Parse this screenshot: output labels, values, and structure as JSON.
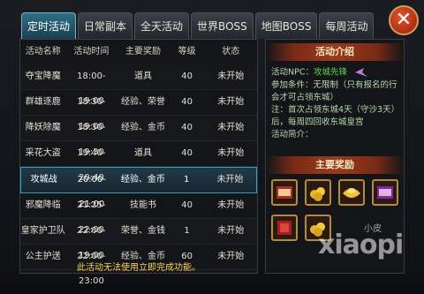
{
  "tabs": [
    "定时活动",
    "日常副本",
    "全天活动",
    "世界BOSS",
    "地图BOSS",
    "每周活动"
  ],
  "close_icon": "close-icon",
  "table": {
    "headers": [
      "活动名称",
      "活动时间",
      "主要奖励",
      "等级",
      "状态"
    ],
    "rows": [
      [
        "夺宝降魔",
        "18:00-19:00",
        "道具",
        "40",
        "未开始"
      ],
      [
        "群雄逐鹿",
        "18:30-19:00",
        "经验、荣誉",
        "40",
        "未开始"
      ],
      [
        "降妖除魔",
        "18:30-19:30",
        "经验、金币",
        "40",
        "未开始"
      ],
      [
        "采花大盗",
        "19:40-20:40",
        "道具",
        "40",
        "未开始"
      ],
      [
        "攻城战",
        "20:00-21:00",
        "经验、金币",
        "1",
        "未开始"
      ],
      [
        "邪魔降临",
        "21:25-22:00",
        "技能书",
        "40",
        "未开始"
      ],
      [
        "皇家护卫队",
        "22:00-19:00",
        "荣誉、金钱",
        "1",
        "未开始"
      ],
      [
        "公主护送",
        "22:00-23:00",
        "经验、金币",
        "60",
        "未开始"
      ]
    ],
    "selected_index": 4
  },
  "footnote": "此活动无法使用立即完成功能。",
  "detail": {
    "title": "活动介绍",
    "npc_label": "活动NPC：",
    "npc_value": "攻城先锋",
    "line1": "参加条件：无限制（只有报名的行会才可占领东城）",
    "line2": "注：首次占领东城4天（守沙3天）后，每周四回收东城皇宫",
    "line3": "活动简介：",
    "rewards_title": "主要奖励"
  },
  "watermark": "xiaopi",
  "watermark_small": "小皮"
}
